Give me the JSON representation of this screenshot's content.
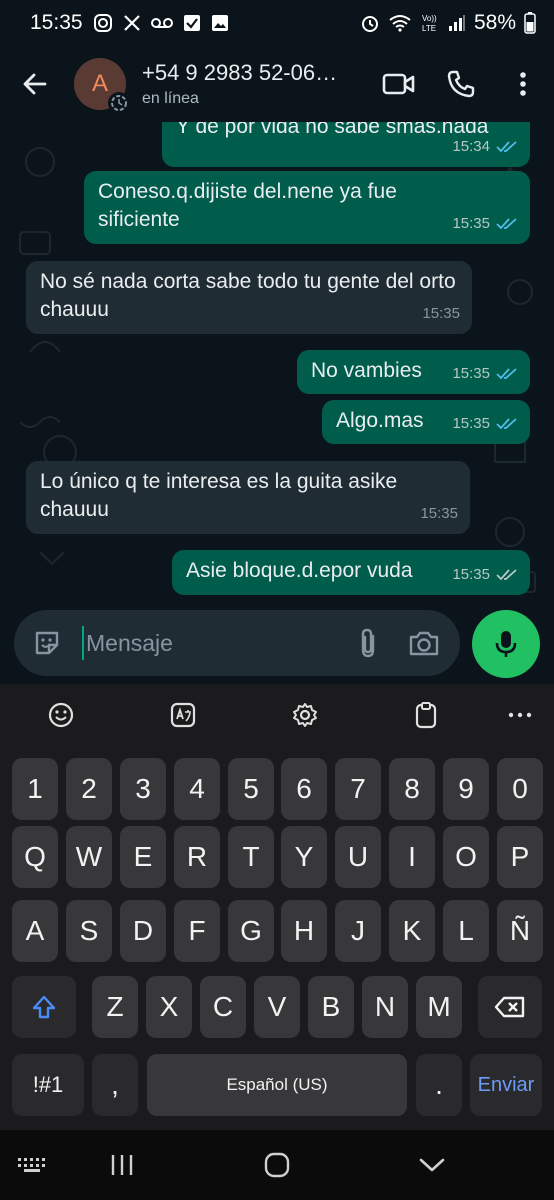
{
  "status_bar": {
    "time": "15:35",
    "battery": "58%",
    "left_icons": [
      "instagram-icon",
      "x-logo-icon",
      "voicemail-icon",
      "checkbox-icon",
      "gallery-icon"
    ],
    "right_icons": [
      "alarm-icon",
      "wifi-icon",
      "volte-icon",
      "signal-icon",
      "battery-icon"
    ]
  },
  "header": {
    "avatar_letter": "A",
    "contact_name": "+54 9 2983 52-06…",
    "contact_status": "en línea",
    "actions": [
      "video-call-icon",
      "phone-call-icon",
      "more-vertical-icon"
    ]
  },
  "messages": [
    {
      "direction": "out",
      "text": "Y de por vida no sabe smas.nada",
      "time": "15:34",
      "status": "read"
    },
    {
      "direction": "out",
      "text": "Coneso.q.dijiste del.nene ya fue sificiente",
      "time": "15:35",
      "status": "read"
    },
    {
      "direction": "in",
      "text": "No sé nada corta sabe todo tu gente del orto chauuu",
      "time": "15:35"
    },
    {
      "direction": "out",
      "text": "No vambies",
      "time": "15:35",
      "status": "read"
    },
    {
      "direction": "out",
      "text": "Algo.mas",
      "time": "15:35",
      "status": "read"
    },
    {
      "direction": "in",
      "text": "Lo único q te interesa es la guita asike chauuu",
      "time": "15:35"
    },
    {
      "direction": "out",
      "text": "Asie bloque.d.epor vuda",
      "time": "15:35",
      "status": "delivered"
    }
  ],
  "composer": {
    "placeholder": "Mensaje",
    "icons": [
      "sticker-icon",
      "attach-icon",
      "camera-icon",
      "mic-icon"
    ]
  },
  "keyboard": {
    "toolbar": [
      "emoji-icon",
      "translate-icon",
      "settings-icon",
      "clipboard-icon",
      "more-horizontal-icon"
    ],
    "row_numbers": [
      "1",
      "2",
      "3",
      "4",
      "5",
      "6",
      "7",
      "8",
      "9",
      "0"
    ],
    "row1": [
      "Q",
      "W",
      "E",
      "R",
      "T",
      "Y",
      "U",
      "I",
      "O",
      "P"
    ],
    "row2": [
      "A",
      "S",
      "D",
      "F",
      "G",
      "H",
      "J",
      "K",
      "L",
      "Ñ"
    ],
    "row3": [
      "Z",
      "X",
      "C",
      "V",
      "B",
      "N",
      "M"
    ],
    "symbols_key": "!#1",
    "comma_key": ",",
    "space_label": "Español (US)",
    "period_key": ".",
    "enter_label": "Enviar"
  },
  "navbar": {
    "buttons": [
      "keyboard-icon",
      "recents-icon",
      "home-icon",
      "back-icon"
    ]
  },
  "colors": {
    "outgoing_bubble": "#005c4b",
    "incoming_bubble": "#202c33",
    "mic_button": "#21c063",
    "read_ticks": "#53bdeb"
  }
}
